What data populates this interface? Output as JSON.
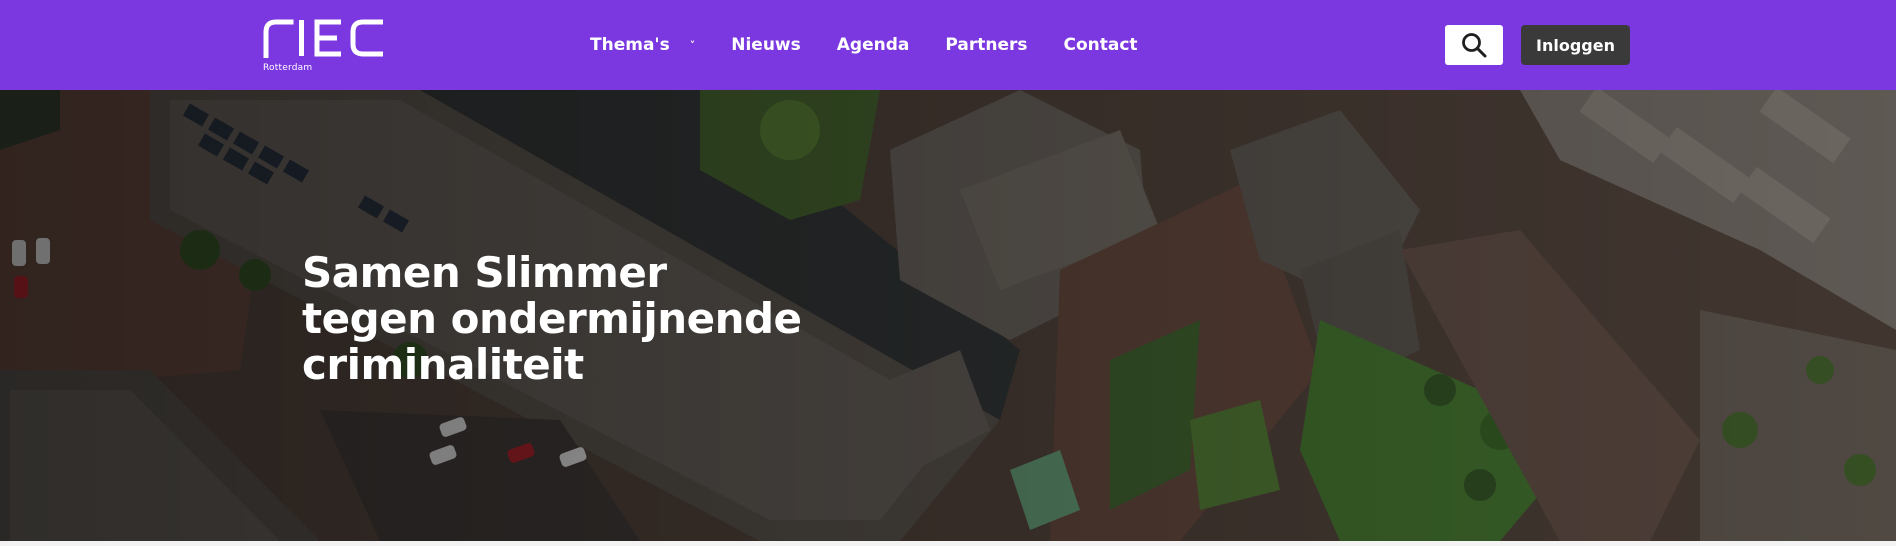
{
  "header": {
    "logo_text": "RIEC",
    "logo_subtitle": "Rotterdam",
    "nav": [
      {
        "label": "Thema's",
        "has_dropdown": true
      },
      {
        "label": "Nieuws"
      },
      {
        "label": "Agenda"
      },
      {
        "label": "Partners"
      },
      {
        "label": "Contact"
      }
    ],
    "search_icon": "search-icon",
    "login_label": "Inloggen"
  },
  "hero": {
    "title_lines": [
      "Samen Slimmer",
      "tegen ondermijnende",
      "criminaliteit"
    ],
    "background": "aerial-photo-of-residential-neighbourhood"
  },
  "colors": {
    "brand_purple": "#7b38e0",
    "login_button": "#3a3a3a",
    "text_white": "#ffffff"
  }
}
